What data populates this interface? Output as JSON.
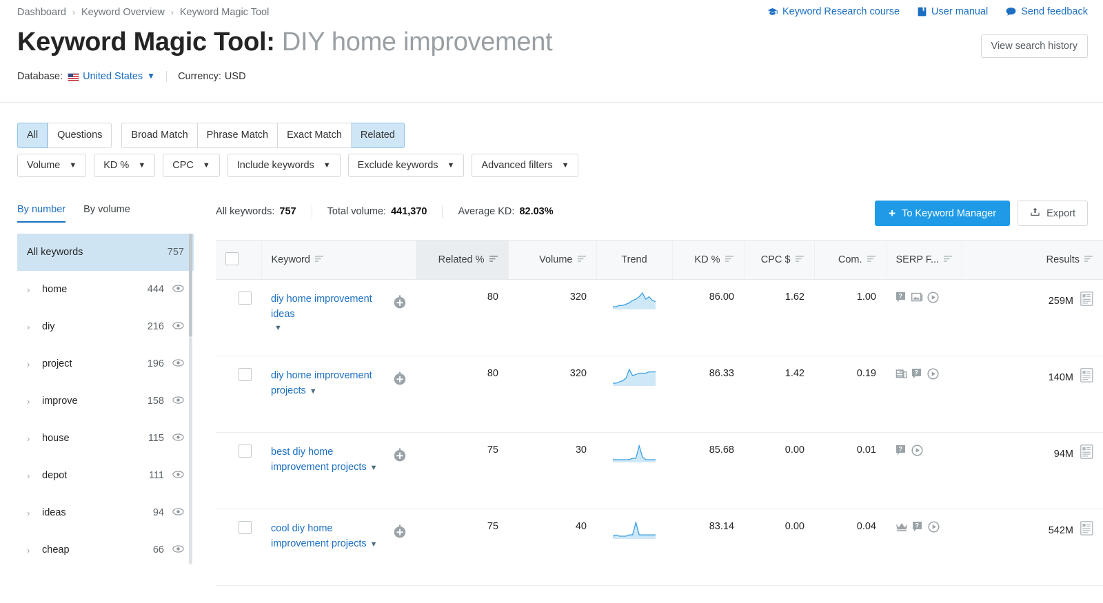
{
  "breadcrumb": {
    "items": [
      {
        "label": "Dashboard"
      },
      {
        "label": "Keyword Overview"
      },
      {
        "label": "Keyword Magic Tool"
      }
    ],
    "separator": "›"
  },
  "toplinks": [
    {
      "label": "Keyword Research course",
      "icon": "graduation-cap-icon"
    },
    {
      "label": "User manual",
      "icon": "book-icon"
    },
    {
      "label": "Send feedback",
      "icon": "chat-bubble-icon"
    }
  ],
  "header": {
    "title_main": "Keyword Magic Tool:",
    "title_query": "DIY home improvement",
    "view_history_label": "View search history",
    "database_label": "Database:",
    "database_value": "United States",
    "currency_label": "Currency:",
    "currency_value": "USD"
  },
  "match_filters": {
    "group1": [
      {
        "label": "All",
        "active": true
      },
      {
        "label": "Questions",
        "active": false
      }
    ],
    "group2": [
      {
        "label": "Broad Match",
        "active": false
      },
      {
        "label": "Phrase Match",
        "active": false
      },
      {
        "label": "Exact Match",
        "active": false
      },
      {
        "label": "Related",
        "active": true
      }
    ]
  },
  "dropdown_filters": [
    {
      "label": "Volume"
    },
    {
      "label": "KD %"
    },
    {
      "label": "CPC"
    },
    {
      "label": "Include keywords"
    },
    {
      "label": "Exclude keywords"
    },
    {
      "label": "Advanced filters"
    }
  ],
  "stats": {
    "all_keywords_label": "All keywords:",
    "all_keywords_value": "757",
    "total_volume_label": "Total volume:",
    "total_volume_value": "441,370",
    "average_kd_label": "Average KD:",
    "average_kd_value": "82.03%"
  },
  "actions": {
    "keyword_manager_label": "To Keyword Manager",
    "plus": "+",
    "export_label": "Export"
  },
  "sidebar": {
    "tabs": [
      {
        "label": "By number",
        "active": true
      },
      {
        "label": "By volume",
        "active": false
      }
    ],
    "all_row": {
      "label": "All keywords",
      "count": "757"
    },
    "groups": [
      {
        "label": "home",
        "count": "444"
      },
      {
        "label": "diy",
        "count": "216"
      },
      {
        "label": "project",
        "count": "196"
      },
      {
        "label": "improve",
        "count": "158"
      },
      {
        "label": "house",
        "count": "115"
      },
      {
        "label": "depot",
        "count": "111"
      },
      {
        "label": "ideas",
        "count": "94"
      },
      {
        "label": "cheap",
        "count": "66"
      }
    ]
  },
  "table": {
    "columns": [
      {
        "key": "check",
        "label": "",
        "align": "left",
        "sortable": false,
        "highlight": false
      },
      {
        "key": "keyword",
        "label": "Keyword",
        "align": "left",
        "sortable": true,
        "highlight": false
      },
      {
        "key": "related",
        "label": "Related %",
        "align": "right",
        "sortable": true,
        "highlight": true
      },
      {
        "key": "volume",
        "label": "Volume",
        "align": "right",
        "sortable": true,
        "highlight": false
      },
      {
        "key": "trend",
        "label": "Trend",
        "align": "center",
        "sortable": false,
        "highlight": false
      },
      {
        "key": "kd",
        "label": "KD %",
        "align": "right",
        "sortable": true,
        "highlight": false
      },
      {
        "key": "cpc",
        "label": "CPC $",
        "align": "right",
        "sortable": true,
        "highlight": false
      },
      {
        "key": "com",
        "label": "Com.",
        "align": "right",
        "sortable": true,
        "highlight": false
      },
      {
        "key": "serp",
        "label": "SERP F...",
        "align": "right",
        "sortable": true,
        "highlight": false
      },
      {
        "key": "results",
        "label": "Results",
        "align": "right",
        "sortable": true,
        "highlight": false
      }
    ],
    "rows": [
      {
        "keyword": "diy home improvement ideas",
        "related": "80",
        "volume": "320",
        "kd": "86.00",
        "cpc": "1.62",
        "com": "1.00",
        "serp_features": [
          "faq-icon",
          "image-pack-icon",
          "video-icon"
        ],
        "results": "259M",
        "trend": [
          14,
          14,
          13,
          13,
          12,
          11,
          9,
          8,
          6,
          3,
          8,
          6,
          9,
          10
        ],
        "caret_below": true
      },
      {
        "keyword": "diy home improvement projects",
        "related": "80",
        "volume": "320",
        "kd": "86.33",
        "cpc": "1.42",
        "com": "0.19",
        "serp_features": [
          "news-icon",
          "faq-icon",
          "video-icon"
        ],
        "results": "140M",
        "trend": [
          14,
          14,
          13,
          12,
          10,
          3,
          8,
          7,
          6,
          6,
          6,
          5,
          5,
          5
        ],
        "caret_below": false
      },
      {
        "keyword": "best diy home improvement projects",
        "related": "75",
        "volume": "30",
        "kd": "85.68",
        "cpc": "0.00",
        "com": "0.01",
        "serp_features": [
          "faq-icon",
          "video-icon"
        ],
        "results": "94M",
        "trend": [
          13,
          13,
          13,
          13,
          13,
          13,
          12,
          12,
          3,
          11,
          13,
          13,
          13,
          13
        ],
        "caret_below": false
      },
      {
        "keyword": "cool diy home improvement projects",
        "related": "75",
        "volume": "40",
        "kd": "83.14",
        "cpc": "0.00",
        "com": "0.04",
        "serp_features": [
          "crown-icon",
          "faq-icon",
          "video-icon"
        ],
        "results": "542M",
        "trend": [
          14,
          13,
          14,
          14,
          14,
          13,
          13,
          3,
          13,
          13,
          13,
          13,
          13,
          13
        ],
        "caret_below": false
      }
    ]
  },
  "colors": {
    "link": "#1b6ec2",
    "accent": "#1e9ae7",
    "active_pill_bg": "#cfe6f7",
    "sidebar_active_bg": "#cfe4f2",
    "spark_line": "#3a9fe0",
    "spark_fill": "#cfe8f8"
  }
}
